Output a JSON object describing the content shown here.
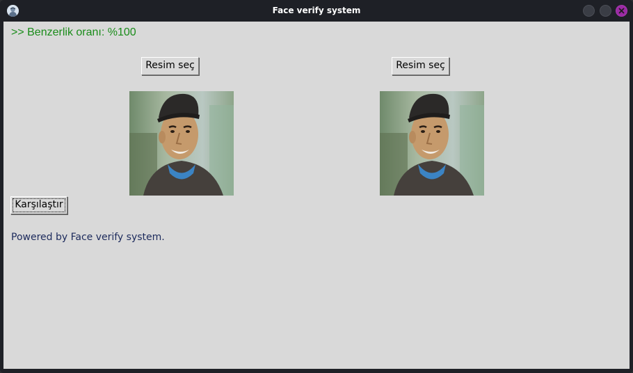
{
  "window": {
    "title": "Face verify system",
    "icons": {
      "app": "app-icon",
      "minimize": "minimize-icon",
      "maximize": "maximize-icon",
      "close": "close-icon"
    },
    "colors": {
      "titlebar": "#1e2026",
      "client_bg": "#d9d9d9",
      "close_button": "#9b2aa4"
    }
  },
  "result": {
    "text": ">> Benzerlik oranı: %100",
    "color": "#1a8c1a"
  },
  "left_panel": {
    "select_button_label": "Resim seç"
  },
  "right_panel": {
    "select_button_label": "Resim seç"
  },
  "compare_button_label": "Karşılaştır",
  "footer": {
    "text": "Powered by Face verify system."
  }
}
